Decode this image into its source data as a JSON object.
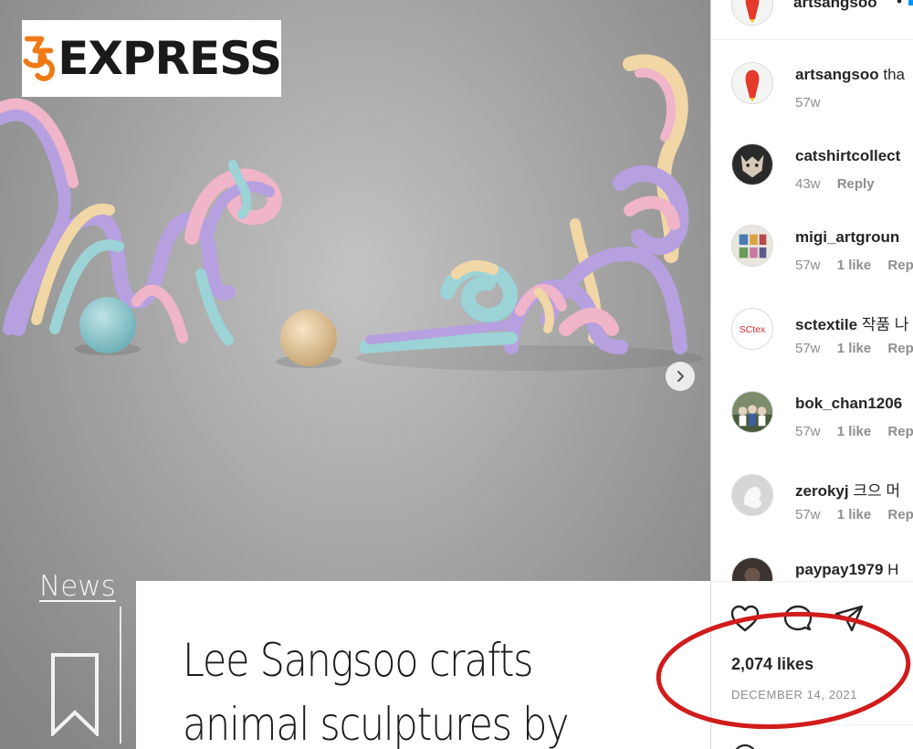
{
  "logo": {
    "number_mark": "35",
    "text": "EXPRESS"
  },
  "article": {
    "section_link": "News",
    "title_line1": "Lee Sangsoo crafts",
    "title_line2": "animal sculptures by"
  },
  "post": {
    "author": "artsangsoo",
    "header_separator": "•",
    "likes": "2,074 likes",
    "date": "DECEMBER 14, 2021"
  },
  "comments": [
    {
      "user": "artsangsoo",
      "text": " tha",
      "time": "57w",
      "likes": "",
      "reply": ""
    },
    {
      "user": "catshirtcollect",
      "text": "",
      "time": "43w",
      "likes": "",
      "reply": "Reply"
    },
    {
      "user": "migi_artgroun",
      "text": "",
      "time": "57w",
      "likes": "1 like",
      "reply": "Rep"
    },
    {
      "user": "sctextile",
      "text": " 작품 나",
      "time": "57w",
      "likes": "1 like",
      "reply": "Rep"
    },
    {
      "user": "bok_chan1206",
      "text": "",
      "time": "57w",
      "likes": "1 like",
      "reply": "Rep"
    },
    {
      "user": "zerokyj",
      "text": " 크으 머",
      "time": "57w",
      "likes": "1 like",
      "reply": "Rep"
    },
    {
      "user": "paypay1979",
      "text": " H",
      "time": "",
      "likes": "",
      "reply": ""
    }
  ],
  "sctex_avatar_text": "SCtex",
  "icons": {
    "next": "chevron-right-icon",
    "bookmark": "bookmark-icon",
    "like": "heart-icon",
    "comment": "comment-icon",
    "share": "paper-plane-icon",
    "emoji": "emoji-icon"
  },
  "colors": {
    "annotation_red": "#d11c1c",
    "logo_orange": "#f07a16",
    "link_blue": "#0095f6",
    "muted_text": "#8e8e8e"
  }
}
